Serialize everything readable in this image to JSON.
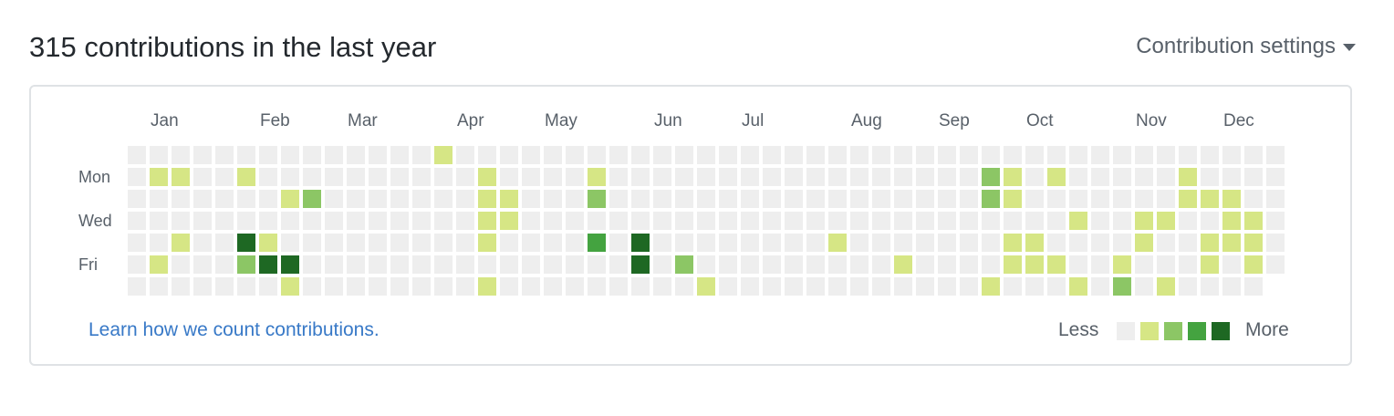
{
  "header": {
    "title": "315 contributions in the last year",
    "settings_label": "Contribution settings"
  },
  "calendar": {
    "months": [
      {
        "label": "Jan",
        "col": 1
      },
      {
        "label": "Feb",
        "col": 6
      },
      {
        "label": "Mar",
        "col": 10
      },
      {
        "label": "Apr",
        "col": 15
      },
      {
        "label": "May",
        "col": 19
      },
      {
        "label": "Jun",
        "col": 24
      },
      {
        "label": "Jul",
        "col": 28
      },
      {
        "label": "Aug",
        "col": 33
      },
      {
        "label": "Sep",
        "col": 37
      },
      {
        "label": "Oct",
        "col": 41
      },
      {
        "label": "Nov",
        "col": 46
      },
      {
        "label": "Dec",
        "col": 50
      }
    ],
    "day_labels": [
      {
        "label": "Mon",
        "row": 1
      },
      {
        "label": "Wed",
        "row": 3
      },
      {
        "label": "Fri",
        "row": 5
      }
    ],
    "colors": [
      "#eeeeee",
      "#d6e685",
      "#8cc665",
      "#44a340",
      "#1e6823"
    ],
    "weeks": 53,
    "rows_in_last_week": 7,
    "last_week_rows": 6,
    "levels": [
      "0000000000000010000000000000000000000000000000000000",
      "0110010000000000100001000000000000000002101000001000",
      "0000000120000000110002000000000000000002100000001110",
      "0000000000000000110000000000000000000000000100110011",
      "0010041000000000100003040000000010000000110000100111",
      "0100024400000000000000040200000000010000111001000101",
      "0000000100000000100000000010000000000001000102010000"
    ],
    "levels_extra": [
      "000000000000000000000000000000000000000000000000000000",
      "000000000000000000000000000000000000000000000000000000"
    ]
  },
  "footer": {
    "learn_link": "Learn how we count contributions.",
    "legend_less": "Less",
    "legend_more": "More"
  }
}
